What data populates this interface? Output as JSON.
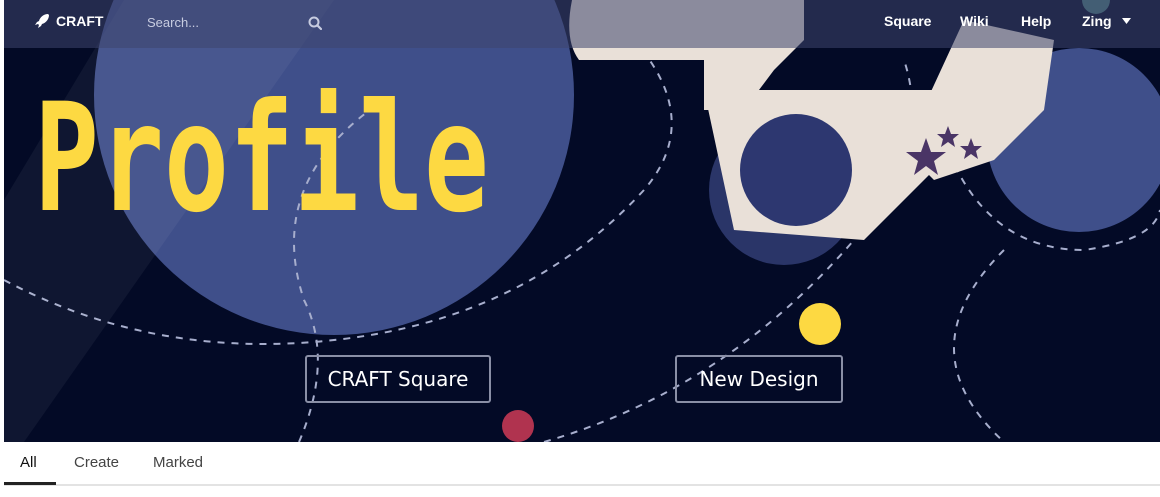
{
  "nav": {
    "brand": "CRAFT",
    "search_placeholder": "Search...",
    "links": [
      "Square",
      "Wiki",
      "Help"
    ],
    "user": "Zing"
  },
  "hero": {
    "title": "Profile",
    "buttons": [
      "CRAFT Square",
      "New Design"
    ]
  },
  "tabs": [
    "All",
    "Create",
    "Marked"
  ],
  "colors": {
    "hero_bg": "#030a26",
    "planet": "#3f4f8a",
    "title_yellow": "#fdd942",
    "astronaut": "#e9e0d8",
    "star_purple": "#4a3566",
    "dot_yellow": "#fdd942",
    "dot_red": "#b0334f",
    "accent_teal": "#4b7d7c"
  }
}
